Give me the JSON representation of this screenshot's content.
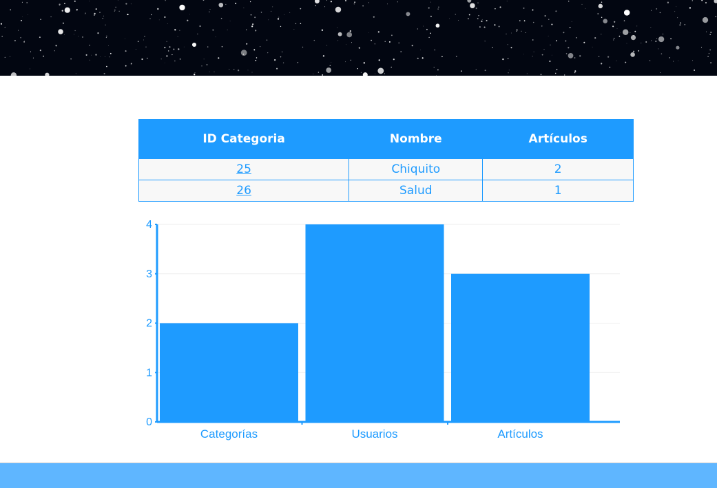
{
  "table": {
    "headers": [
      "ID Categoria",
      "Nombre",
      "Artículos"
    ],
    "rows": [
      {
        "id": "25",
        "name": "Chiquito",
        "articles": "2"
      },
      {
        "id": "26",
        "name": "Salud",
        "articles": "1"
      }
    ]
  },
  "chart_data": {
    "type": "bar",
    "categories": [
      "Categorías",
      "Usuarios",
      "Artículos"
    ],
    "values": [
      2,
      4,
      3
    ],
    "yticks": [
      "0",
      "1",
      "2",
      "3",
      "4"
    ],
    "ylim": [
      0,
      4
    ],
    "grid": true,
    "color": "#1e9bff"
  },
  "colors": {
    "accent": "#1e9bff",
    "footer": "#5fb6ff",
    "banner": "#020611"
  }
}
